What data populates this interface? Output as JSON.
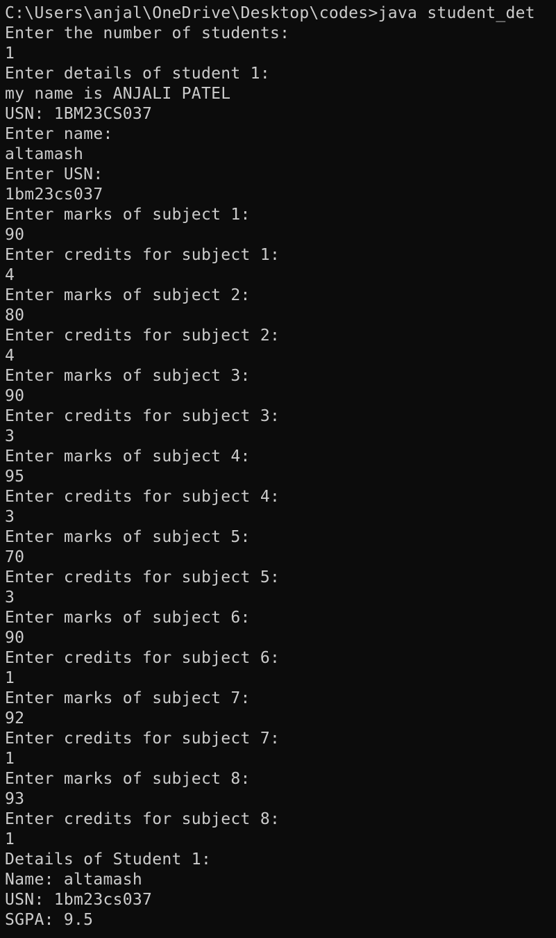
{
  "terminal": {
    "lines": [
      "C:\\Users\\anjal\\OneDrive\\Desktop\\codes>java student_det",
      "Enter the number of students:",
      "1",
      "Enter details of student 1:",
      "my name is ANJALI PATEL",
      "USN: 1BM23CS037",
      "Enter name:",
      "altamash",
      "Enter USN:",
      "1bm23cs037",
      "Enter marks of subject 1:",
      "90",
      "Enter credits for subject 1:",
      "4",
      "Enter marks of subject 2:",
      "80",
      "Enter credits for subject 2:",
      "4",
      "Enter marks of subject 3:",
      "90",
      "Enter credits for subject 3:",
      "3",
      "Enter marks of subject 4:",
      "95",
      "Enter credits for subject 4:",
      "3",
      "Enter marks of subject 5:",
      "70",
      "Enter credits for subject 5:",
      "3",
      "Enter marks of subject 6:",
      "90",
      "Enter credits for subject 6:",
      "1",
      "Enter marks of subject 7:",
      "92",
      "Enter credits for subject 7:",
      "1",
      "Enter marks of subject 8:",
      "93",
      "Enter credits for subject 8:",
      "1",
      "Details of Student 1:",
      "Name: altamash",
      "USN: 1bm23cs037",
      "SGPA: 9.5"
    ]
  }
}
